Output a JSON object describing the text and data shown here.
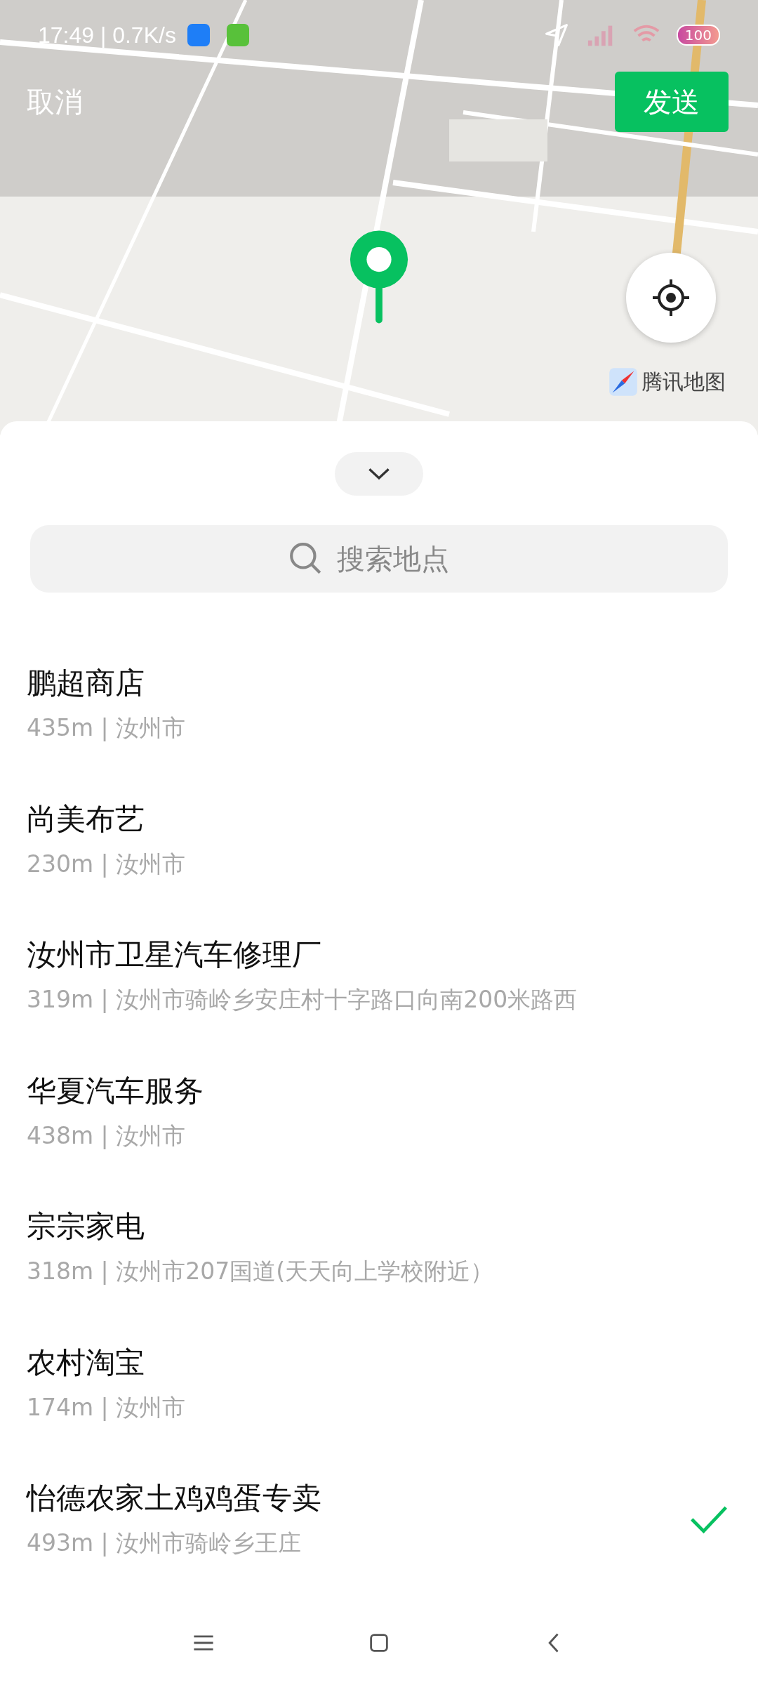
{
  "status_bar": {
    "time_speed": "17:49 | 0.7K/s",
    "battery": "100"
  },
  "top_bar": {
    "cancel": "取消",
    "send": "发送"
  },
  "map": {
    "attribution": "腾讯地图"
  },
  "search": {
    "placeholder": "搜索地点"
  },
  "places": [
    {
      "name": "鹏超商店",
      "detail": "435m | 汝州市",
      "selected": false
    },
    {
      "name": "尚美布艺",
      "detail": "230m | 汝州市",
      "selected": false
    },
    {
      "name": "汝州市卫星汽车修理厂",
      "detail": "319m | 汝州市骑岭乡安庄村十字路口向南200米路西",
      "selected": false
    },
    {
      "name": "华夏汽车服务",
      "detail": "438m | 汝州市",
      "selected": false
    },
    {
      "name": "宗宗家电",
      "detail": "318m | 汝州市207国道(天天向上学校附近）",
      "selected": false
    },
    {
      "name": "农村淘宝",
      "detail": "174m | 汝州市",
      "selected": false
    },
    {
      "name": "怡德农家土鸡鸡蛋专卖",
      "detail": "493m | 汝州市骑岭乡王庄",
      "selected": true
    }
  ]
}
